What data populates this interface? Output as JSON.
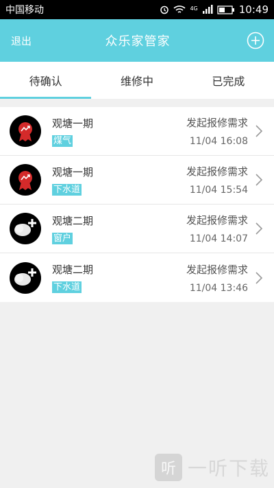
{
  "statusbar": {
    "carrier": "中国移动",
    "network": "4G",
    "time": "10:49"
  },
  "header": {
    "logout_label": "退出",
    "title": "众乐家管家"
  },
  "tabs": [
    {
      "label": "待确认",
      "active": true
    },
    {
      "label": "维修中",
      "active": false
    },
    {
      "label": "已完成",
      "active": false
    }
  ],
  "requests": [
    {
      "avatar": "red-badge-icon",
      "area": "观塘一期",
      "tag": "煤气",
      "action": "发起报修需求",
      "time": "11/04 16:08"
    },
    {
      "avatar": "red-badge-icon",
      "area": "观塘一期",
      "tag": "下水道",
      "action": "发起报修需求",
      "time": "11/04 15:54"
    },
    {
      "avatar": "cloud-plus-icon",
      "area": "观塘二期",
      "tag": "窗户",
      "action": "发起报修需求",
      "time": "11/04 14:07"
    },
    {
      "avatar": "cloud-plus-icon",
      "area": "观塘二期",
      "tag": "下水道",
      "action": "发起报修需求",
      "time": "11/04 13:46"
    }
  ],
  "watermark": {
    "logo": "听",
    "text": "一听下载"
  },
  "colors": {
    "accent": "#5fd0df",
    "badge_red": "#d42a2a"
  }
}
